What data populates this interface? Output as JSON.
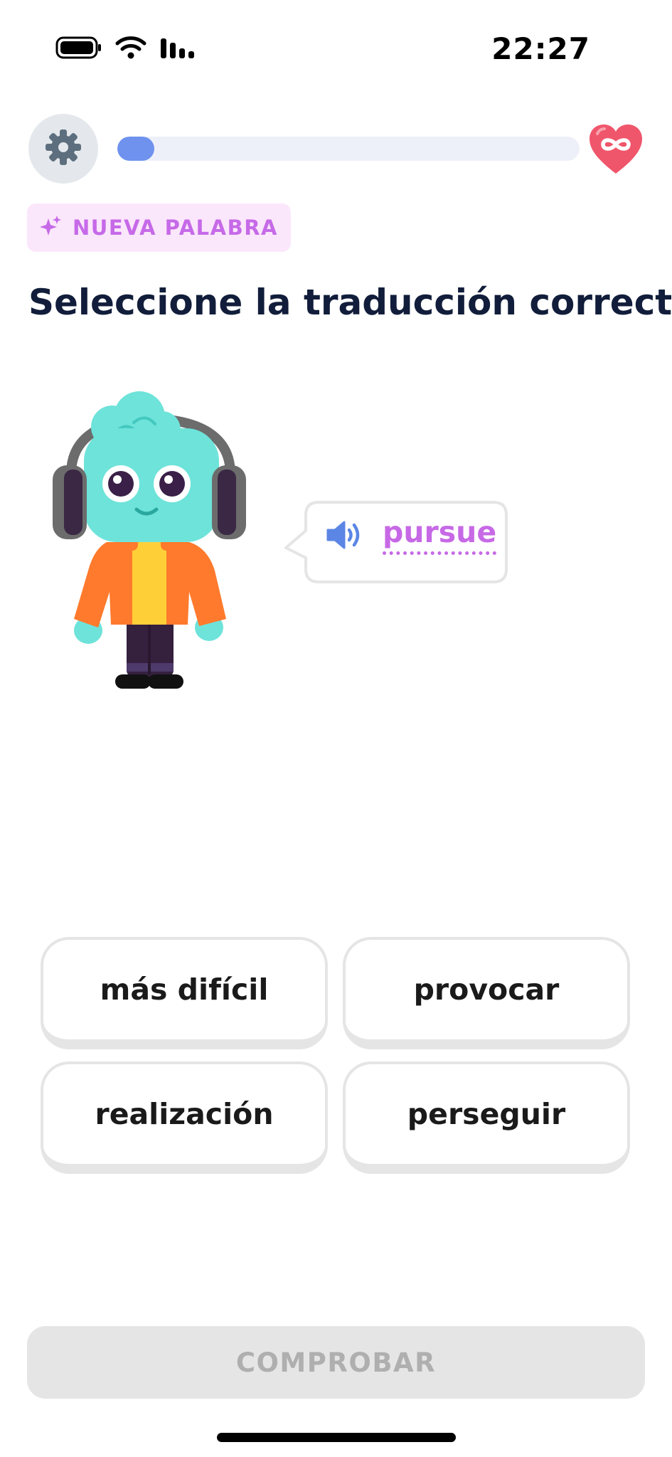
{
  "status_bar": {
    "time": "22:27",
    "icons": [
      "battery-icon",
      "wifi-icon",
      "cellular-signal-icon"
    ]
  },
  "header": {
    "settings_icon": "gear-icon",
    "progress_fraction": 0.08,
    "hearts_icon": "heart-infinity-icon"
  },
  "badge": {
    "icon": "sparkle-icon",
    "label": "NUEVA PALABRA"
  },
  "prompt": {
    "title": "Seleccione la traducción correcta"
  },
  "speech_bubble": {
    "icon": "speaker-icon",
    "word": "pursue"
  },
  "options": [
    {
      "label": "más difícil"
    },
    {
      "label": "provocar"
    },
    {
      "label": "realización"
    },
    {
      "label": "perseguir"
    }
  ],
  "footer": {
    "check_label": "COMPROBAR"
  },
  "colors": {
    "accent_purple": "#c769e6",
    "progress_blue": "#6f92ef",
    "heart_red": "#f0566b",
    "title_navy": "#111d3a"
  }
}
